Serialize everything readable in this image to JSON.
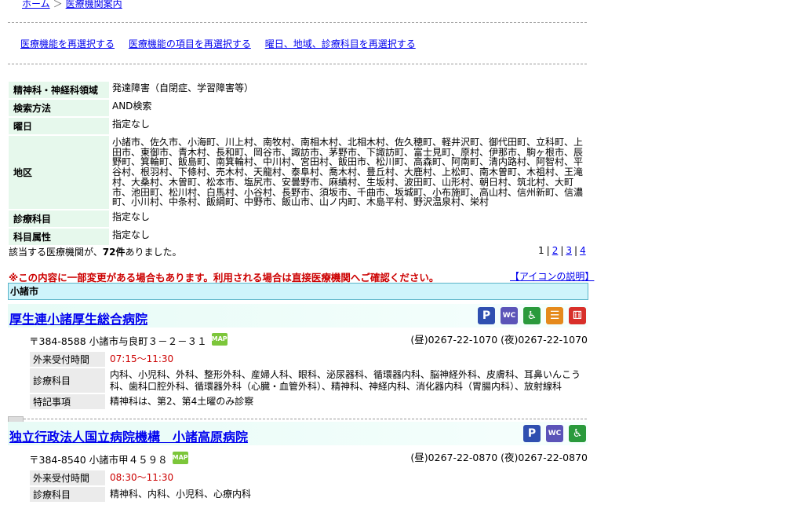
{
  "breadcrumb": {
    "home": "ホーム",
    "current": "医療機関案内",
    "sep": "＞"
  },
  "relinks": [
    "医療機能を再選択する",
    "医療機能の項目を再選択する",
    "曜日、地域、診療科目を再選択する"
  ],
  "conditions": [
    {
      "label": "精神科・神経科領域",
      "value": "発達障害（自閉症、学習障害等）"
    },
    {
      "label": "検索方法",
      "value": "AND検索"
    },
    {
      "label": "曜日",
      "value": "指定なし"
    },
    {
      "label": "地区",
      "value": "小諸市、佐久市、小海町、川上村、南牧村、南相木村、北相木村、佐久穂町、軽井沢町、御代田町、立科町、上田市、東御市、青木村、長和町、岡谷市、諏訪市、茅野市、下諏訪町、富士見町、原村、伊那市、駒ヶ根市、辰野町、箕輪町、飯島町、南箕輪村、中川村、宮田村、飯田市、松川町、高森町、阿南町、清内路村、阿智村、平谷村、根羽村、下條村、売木村、天龍村、泰阜村、喬木村、豊丘村、大鹿村、上松町、南木曽町、木祖村、王滝村、大桑村、木曽町、松本市、塩尻市、安曇野市、麻績村、生坂村、波田町、山形村、朝日村、筑北村、大町市、池田町、松川村、白馬村、小谷村、長野市、須坂市、千曲市、坂城町、小布施町、高山村、信州新町、信濃町、小川村、中条村、飯綱町、中野市、飯山市、山ノ内町、木島平村、野沢温泉村、栄村"
    },
    {
      "label": "診療科目",
      "value": "指定なし"
    },
    {
      "label": "科目属性",
      "value": "指定なし"
    }
  ],
  "result": {
    "prefix": "該当する医療機関が、",
    "count": "72件",
    "suffix": "ありました。"
  },
  "pager": {
    "current": "1",
    "pages": [
      "2",
      "3",
      "4"
    ]
  },
  "notice": "※この内容に一部変更がある場合もあります。利用される場合は直接医療機関へご確認ください。",
  "icon_help": "【アイコンの説明】",
  "city": "小諸市",
  "hospitals": [
    {
      "name": "厚生連小諸厚生総合病院",
      "address": "〒384-8588 小諸市与良町３－２－３１",
      "tel": "(昼)0267-22-1070 (夜)0267-22-1070",
      "icons": [
        {
          "name": "parking-icon",
          "glyph": "P",
          "color": "#2f4fb0"
        },
        {
          "name": "accessible-toilet-icon",
          "glyph": "WC",
          "color": "#5b54b8"
        },
        {
          "name": "wheelchair-icon",
          "glyph": "♿",
          "color": "#2a9a3c"
        },
        {
          "name": "stairs-icon",
          "glyph": "☰",
          "color": "#e58a1c"
        },
        {
          "name": "dice-icon",
          "glyph": "⚅",
          "color": "#d8302a"
        }
      ],
      "rows": [
        {
          "label": "外来受付時間",
          "value": "07:15～11:30",
          "red": true
        },
        {
          "label": "診療科目",
          "value": "内科、小児科、外科、整形外科、産婦人科、眼科、泌尿器科、循環器内科、脳神経外科、皮膚科、耳鼻いんこう科、歯科口腔外科、循環器外科（心臓・血管外科）、精神科、神経内科、消化器内科（胃腸内科）、放射線科",
          "red": false
        },
        {
          "label": "特記事項",
          "value": "精神科は、第2、第4土曜のみ診察",
          "red": false
        }
      ]
    },
    {
      "name": "独立行政法人国立病院機構　小諸高原病院",
      "address": "〒384-8540 小諸市甲４５９８",
      "tel": "(昼)0267-22-0870 (夜)0267-22-0870",
      "icons": [
        {
          "name": "parking-icon",
          "glyph": "P",
          "color": "#2f4fb0"
        },
        {
          "name": "accessible-toilet-icon",
          "glyph": "WC",
          "color": "#5b54b8"
        },
        {
          "name": "wheelchair-icon",
          "glyph": "♿",
          "color": "#2a9a3c"
        }
      ],
      "rows": [
        {
          "label": "外来受付時間",
          "value": "08:30～11:30",
          "red": true
        },
        {
          "label": "診療科目",
          "value": "精神科、内科、小児科、心療内科",
          "red": false
        }
      ]
    }
  ],
  "map_label": "MAP"
}
